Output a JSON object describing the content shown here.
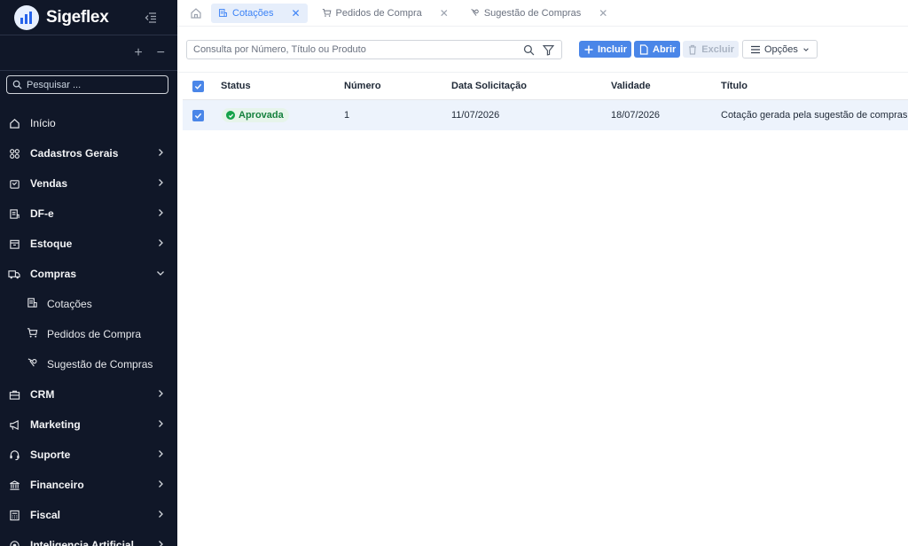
{
  "brand": {
    "name": "Sigeflex"
  },
  "sidebar": {
    "search_placeholder": "Pesquisar ...",
    "add_label": "+",
    "remove_label": "−",
    "items": [
      {
        "label": "Início",
        "icon": "home-icon",
        "expandable": false
      },
      {
        "label": "Cadastros Gerais",
        "icon": "grid-icon",
        "expandable": true
      },
      {
        "label": "Vendas",
        "icon": "shopping-bag-icon",
        "expandable": true
      },
      {
        "label": "DF-e",
        "icon": "document-icon",
        "expandable": true
      },
      {
        "label": "Estoque",
        "icon": "archive-icon",
        "expandable": true
      },
      {
        "label": "Compras",
        "icon": "truck-icon",
        "expandable": true,
        "expanded": true,
        "children": [
          {
            "label": "Cotações",
            "icon": "quote-doc-icon"
          },
          {
            "label": "Pedidos de Compra",
            "icon": "cart-icon"
          },
          {
            "label": "Sugestão de Compras",
            "icon": "suggestion-icon"
          }
        ]
      },
      {
        "label": "CRM",
        "icon": "briefcase-icon",
        "expandable": true
      },
      {
        "label": "Marketing",
        "icon": "megaphone-icon",
        "expandable": true
      },
      {
        "label": "Suporte",
        "icon": "headset-icon",
        "expandable": true
      },
      {
        "label": "Financeiro",
        "icon": "bank-icon",
        "expandable": true
      },
      {
        "label": "Fiscal",
        "icon": "calculator-icon",
        "expandable": true
      },
      {
        "label": "Inteligencia Artificial",
        "icon": "ai-icon",
        "expandable": true
      }
    ]
  },
  "tabs": [
    {
      "label": "Cotações",
      "active": true
    },
    {
      "label": "Pedidos de Compra",
      "active": false
    },
    {
      "label": "Sugestão de Compras",
      "active": false
    }
  ],
  "toolbar": {
    "query_placeholder": "Consulta por Número, Título ou Produto",
    "include_label": "Incluir",
    "open_label": "Abrir",
    "delete_label": "Excluir",
    "options_label": "Opções"
  },
  "table": {
    "columns": [
      "Status",
      "Número",
      "Data Solicitação",
      "Validade",
      "Título"
    ],
    "rows": [
      {
        "status": "Aprovada",
        "numero": "1",
        "data_solicitacao": "11/07/2026",
        "validade": "18/07/2026",
        "titulo": "Cotação gerada pela sugestão de compras"
      }
    ]
  },
  "colors": {
    "sidebar_bg": "#101728",
    "accent": "#4a86e8",
    "approved": "#16a34a"
  }
}
